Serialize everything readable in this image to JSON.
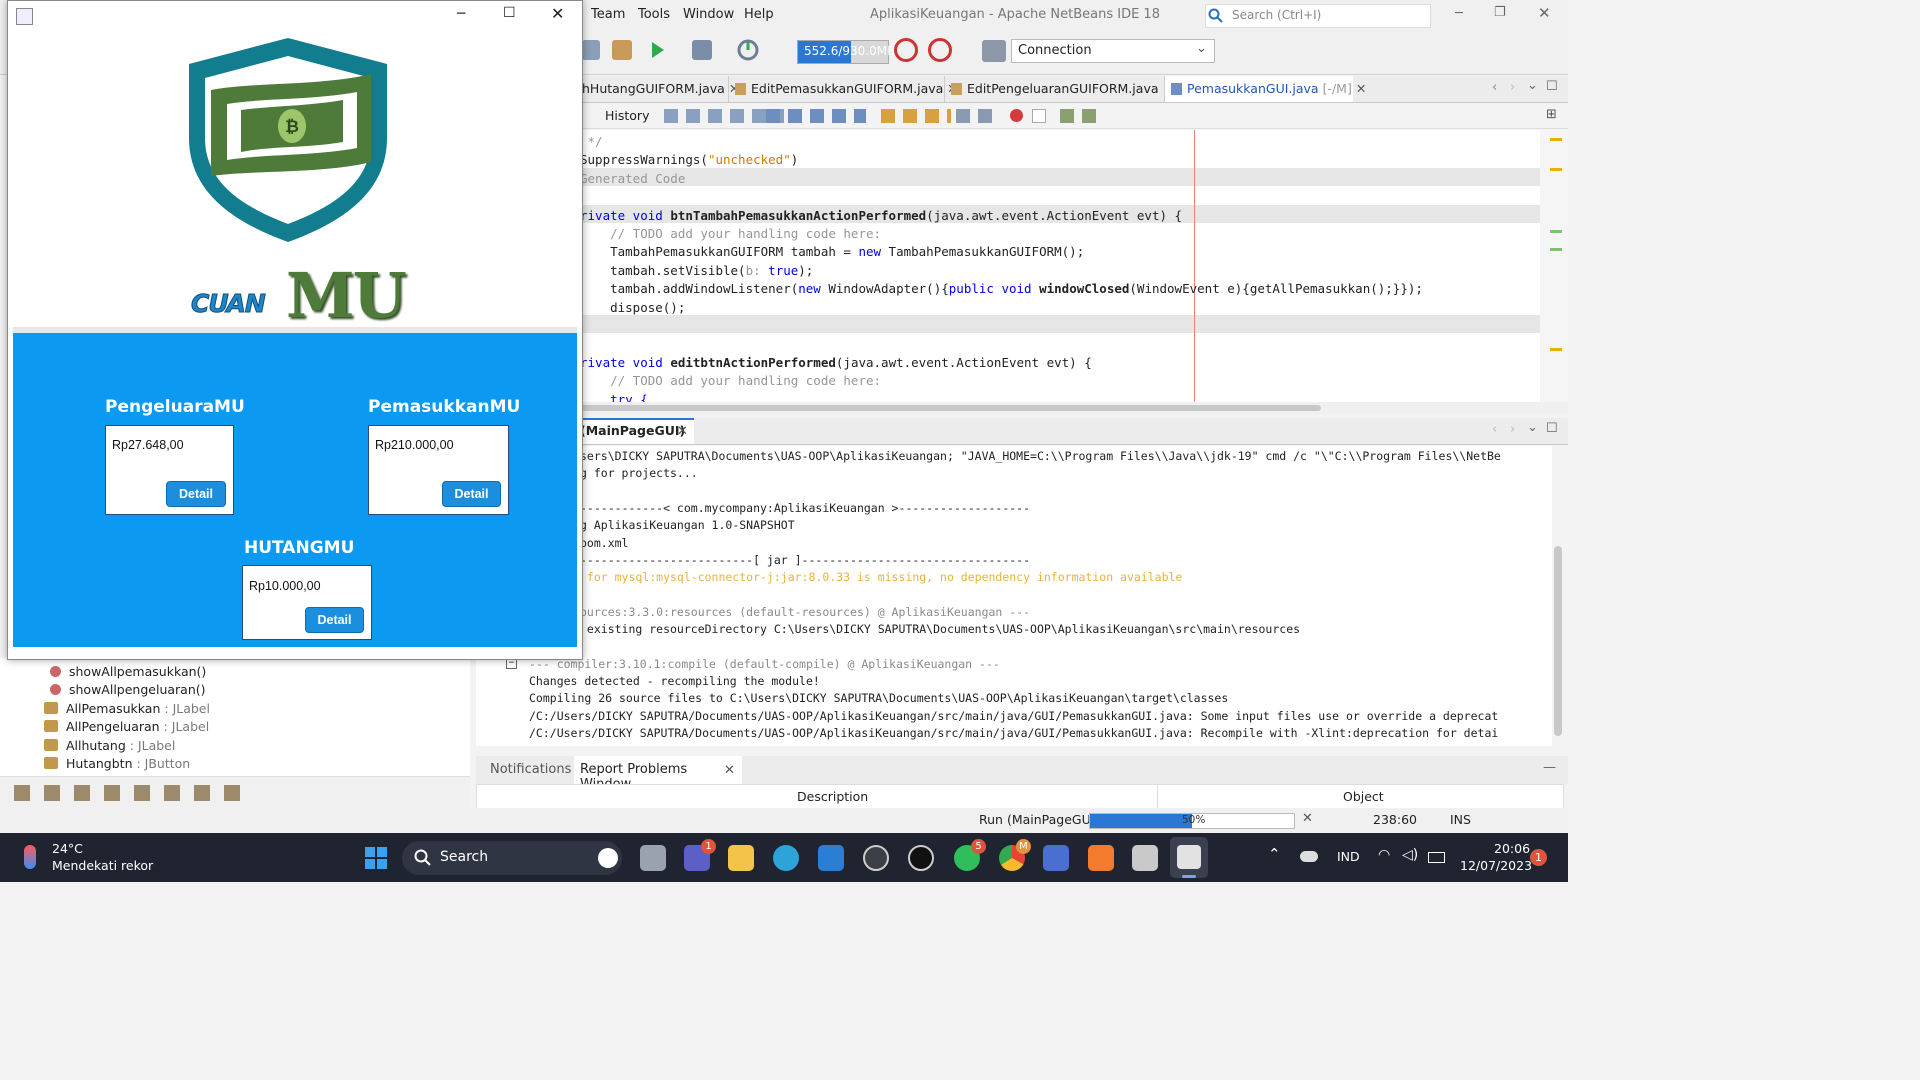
{
  "ide": {
    "title": "AplikasiKeuangan - Apache NetBeans IDE 18",
    "menu": [
      "Team",
      "Tools",
      "Window",
      "Help"
    ],
    "search_placeholder": "Search (Ctrl+I)",
    "memory": "552.6/930.0MB",
    "memory_fraction": 0.594,
    "connection": "Connection",
    "file_tabs": [
      "hHutangGUIFORM.java",
      "EditPemasukkanGUIFORM.java",
      "EditPengeluaranGUIFORM.java",
      "PemasukkanGUI.java",
      "[-/M]"
    ],
    "history_label": "History",
    "code_lines": [
      {
        "segs": [
          {
            "t": " */",
            "c": "cmt"
          }
        ]
      },
      {
        "segs": [
          {
            "t": "SuppressWarnings(",
            "c": ""
          },
          {
            "t": "\"unchecked\"",
            "c": "str"
          },
          {
            "t": ")",
            "c": ""
          }
        ]
      },
      {
        "segs": [
          {
            "t": "Generated Code",
            "c": "cmt"
          }
        ]
      },
      {
        "segs": [
          {
            "t": "",
            "c": ""
          }
        ]
      },
      {
        "segs": [
          {
            "t": "rivate void ",
            "c": "kw"
          },
          {
            "t": "btnTambahPemasukkanActionPerformed",
            "c": "bold"
          },
          {
            "t": "(java.awt.event.ActionEvent evt) {",
            "c": ""
          }
        ]
      },
      {
        "segs": [
          {
            "t": "    // TODO add your handling code here:",
            "c": "cmt"
          }
        ]
      },
      {
        "segs": [
          {
            "t": "    TambahPemasukkanGUIFORM tambah = ",
            "c": ""
          },
          {
            "t": "new",
            "c": "kw"
          },
          {
            "t": " TambahPemasukkanGUIFORM();",
            "c": ""
          }
        ]
      },
      {
        "segs": [
          {
            "t": "    tambah.setVisible(",
            "c": ""
          },
          {
            "t": "b:",
            "c": "cmt"
          },
          {
            "t": " true",
            "c": "kw"
          },
          {
            "t": ");",
            "c": ""
          }
        ]
      },
      {
        "segs": [
          {
            "t": "    tambah.addWindowListener(",
            "c": ""
          },
          {
            "t": "new",
            "c": "kw"
          },
          {
            "t": " WindowAdapter(){",
            "c": ""
          },
          {
            "t": "public void",
            "c": "kw"
          },
          {
            "t": " windowClosed",
            "c": "bold"
          },
          {
            "t": "(WindowEvent e){getAllPemasukkan();}});",
            "c": ""
          }
        ]
      },
      {
        "segs": [
          {
            "t": "    dispose();",
            "c": ""
          }
        ]
      },
      {
        "segs": [
          {
            "t": "",
            "c": ""
          }
        ]
      },
      {
        "segs": [
          {
            "t": "",
            "c": ""
          }
        ]
      },
      {
        "segs": [
          {
            "t": "rivate void ",
            "c": "kw"
          },
          {
            "t": "editbtnActionPerformed",
            "c": "bold"
          },
          {
            "t": "(java.awt.event.ActionEvent evt) {",
            "c": ""
          }
        ]
      },
      {
        "segs": [
          {
            "t": "    // TODO add your handling code here:",
            "c": "cmt"
          }
        ]
      },
      {
        "segs": [
          {
            "t": "    try {",
            "c": "kw"
          }
        ]
      }
    ],
    "output_tab": "(MainPageGUI)",
    "output_lines": [
      {
        "t": "sers\\DICKY SAPUTRA\\Documents\\UAS-OOP\\AplikasiKeuangan; \"JAVA_HOME=C:\\\\Program Files\\\\Java\\\\jdk-19\" cmd /c \"\\\"C:\\\\Program Files\\\\NetBe",
        "c": "",
        "x": 0
      },
      {
        "t": "g for projects...",
        "c": "",
        "x": 0
      },
      {
        "t": "",
        "c": "",
        "x": 0
      },
      {
        "t": "------------< com.mycompany:AplikasiKeuangan >-------------------",
        "c": "",
        "x": 0
      },
      {
        "t": "g AplikasiKeuangan 1.0-SNAPSHOT",
        "c": "",
        "x": 0
      },
      {
        "t": "pom.xml",
        "c": "",
        "x": 0
      },
      {
        "t": "-------------------------[ jar ]---------------------------------",
        "c": "",
        "x": 0
      },
      {
        "t": " for mysql:mysql-connector-j:jar:8.0.33 is missing, no dependency information available",
        "c": "warn",
        "x": 0
      },
      {
        "t": "",
        "c": "",
        "x": 0
      },
      {
        "t": "ources:3.3.0:resources (default-resources) @ AplikasiKeuangan ---",
        "c": "gray",
        "x": 0
      },
      {
        "t": " existing resourceDirectory C:\\Users\\DICKY SAPUTRA\\Documents\\UAS-OOP\\AplikasiKeuangan\\src\\main\\resources",
        "c": "",
        "x": 0
      },
      {
        "t": "",
        "c": "",
        "x": 0
      },
      {
        "t": "--- compiler:3.10.1:compile (default-compile) @ AplikasiKeuangan ---",
        "c": "gray",
        "x": -51
      },
      {
        "t": "Changes detected - recompiling the module!",
        "c": "",
        "x": -51
      },
      {
        "t": "Compiling 26 source files to C:\\Users\\DICKY SAPUTRA\\Documents\\UAS-OOP\\AplikasiKeuangan\\target\\classes",
        "c": "",
        "x": -51
      },
      {
        "t": "/C:/Users/DICKY SAPUTRA/Documents/UAS-OOP/AplikasiKeuangan/src/main/java/GUI/PemasukkanGUI.java: Some input files use or override a deprecat",
        "c": "",
        "x": -51
      },
      {
        "t": "/C:/Users/DICKY SAPUTRA/Documents/UAS-OOP/AplikasiKeuangan/src/main/java/GUI/PemasukkanGUI.java: Recompile with -Xlint:deprecation for detai",
        "c": "",
        "x": -51
      }
    ],
    "bottom_tabs": [
      "Notifications",
      "Report Problems Window"
    ],
    "problems_columns": [
      "Description",
      "Object"
    ],
    "navigator_items": [
      {
        "name": "showAllpemasukkan()",
        "type": "",
        "kind": "method"
      },
      {
        "name": "showAllpengeluaran()",
        "type": "",
        "kind": "method"
      },
      {
        "name": "AllPemasukkan",
        "type": " : JLabel",
        "kind": "field"
      },
      {
        "name": "AllPengeluaran",
        "type": " : JLabel",
        "kind": "field"
      },
      {
        "name": "Allhutang",
        "type": " : JLabel",
        "kind": "field"
      },
      {
        "name": "Hutangbtn",
        "type": " : JButton",
        "kind": "field"
      }
    ],
    "status": {
      "run": "Run (MainPageGUI)",
      "progress": "50%",
      "progress_fraction": 0.5,
      "position": "238:60",
      "mode": "INS"
    }
  },
  "app": {
    "brand_small": "CUAN",
    "brand_big": "MU",
    "cards": {
      "pengeluaran": {
        "title": "PengeluaraMU",
        "value": "Rp27.648,00",
        "button": "Detail"
      },
      "pemasukkan": {
        "title": "PemasukkanMU",
        "value": "Rp210.000,00",
        "button": "Detail"
      },
      "hutang": {
        "title": "HUTANGMU",
        "value": "Rp10.000,00",
        "button": "Detail"
      }
    }
  },
  "taskbar": {
    "weather_temp": "24°C",
    "weather_text": "Mendekati rekor",
    "search": "Search",
    "lang": "IND",
    "time": "20:06",
    "date": "12/07/2023",
    "notif_count": "1",
    "badges": {
      "teams": "1",
      "whatsapp": "5",
      "chrome": "M"
    }
  },
  "colors": {
    "app_blue": "#0b99f2",
    "button_blue": "#1b8fde",
    "shield_teal": "#127d8f",
    "money_green": "#4e7a3a"
  }
}
